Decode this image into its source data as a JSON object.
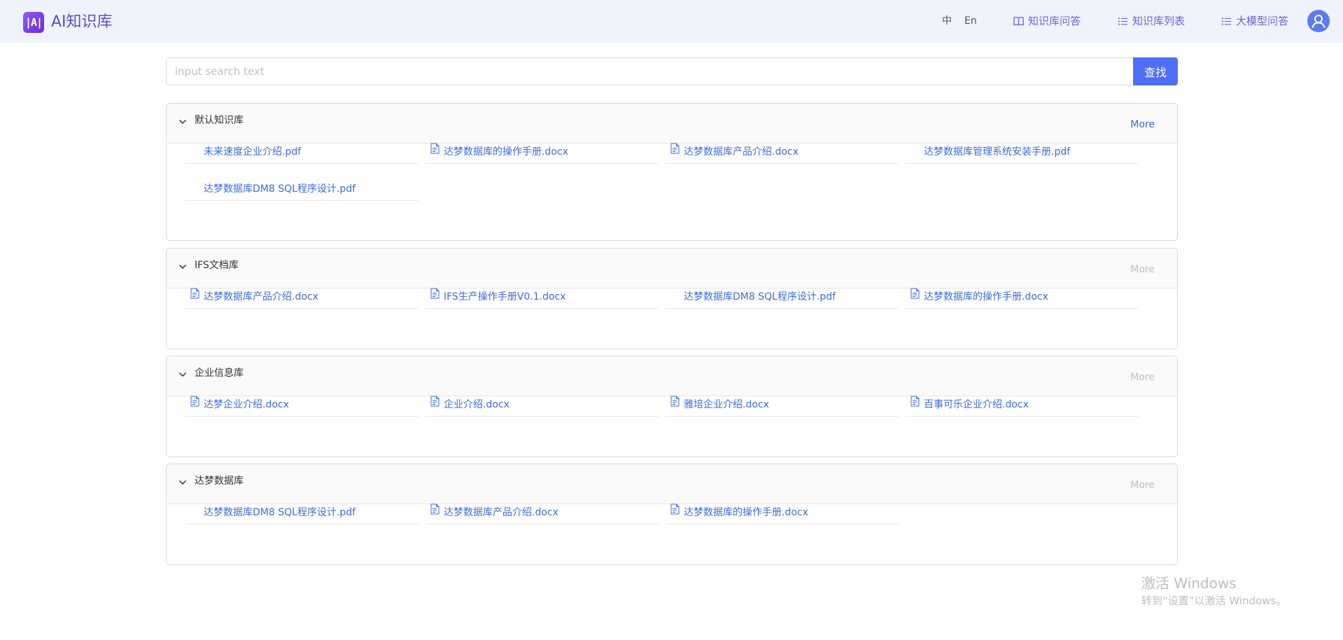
{
  "header": {
    "logo_text": "|A|",
    "app_title": "AI知识库",
    "lang_zh": "中",
    "lang_en": "En",
    "nav": [
      {
        "label": "知识库问答",
        "icon": "book-icon"
      },
      {
        "label": "知识库列表",
        "icon": "list-icon"
      },
      {
        "label": "大模型问答",
        "icon": "list-icon"
      }
    ],
    "avatar_icon": "user-icon"
  },
  "search": {
    "placeholder": "input search text",
    "value": "",
    "button_label": "查找"
  },
  "panels": [
    {
      "title": "默认知识库",
      "more_label": "More",
      "more_active": true,
      "files": [
        {
          "name": "未来速度企业介绍.pdf",
          "icon": false
        },
        {
          "name": "达梦数据库的操作手册.docx",
          "icon": true
        },
        {
          "name": "达梦数据库产品介绍.docx",
          "icon": true
        },
        {
          "name": "达梦数据库管理系统安装手册.pdf",
          "icon": false
        },
        {
          "name": "达梦数据库DM8 SQL程序设计.pdf",
          "icon": false
        }
      ]
    },
    {
      "title": "IFS文档库",
      "more_label": "More",
      "more_active": false,
      "files": [
        {
          "name": "达梦数据库产品介绍.docx",
          "icon": true
        },
        {
          "name": "IFS生产操作手册V0.1.docx",
          "icon": true
        },
        {
          "name": "达梦数据库DM8 SQL程序设计.pdf",
          "icon": false
        },
        {
          "name": "达梦数据库的操作手册.docx",
          "icon": true
        }
      ]
    },
    {
      "title": "企业信息库",
      "more_label": "More",
      "more_active": false,
      "files": [
        {
          "name": "达梦企业介绍.docx",
          "icon": true
        },
        {
          "name": "企业介绍.docx",
          "icon": true
        },
        {
          "name": "雅培企业介绍.docx",
          "icon": true
        },
        {
          "name": "百事可乐企业介绍.docx",
          "icon": true
        }
      ]
    },
    {
      "title": "达梦数据库",
      "more_label": "More",
      "more_active": false,
      "files": [
        {
          "name": "达梦数据库DM8 SQL程序设计.pdf",
          "icon": false
        },
        {
          "name": "达梦数据库产品介绍.docx",
          "icon": true
        },
        {
          "name": "达梦数据库的操作手册.docx",
          "icon": true
        }
      ]
    }
  ],
  "watermark": {
    "line1": "激活 Windows",
    "line2": "转到“设置”以激活 Windows。"
  },
  "colors": {
    "accent": "#4f6ef6",
    "link": "#3b6ae0",
    "nav": "#6b63d6",
    "header_bg": "#f0f3fc"
  }
}
